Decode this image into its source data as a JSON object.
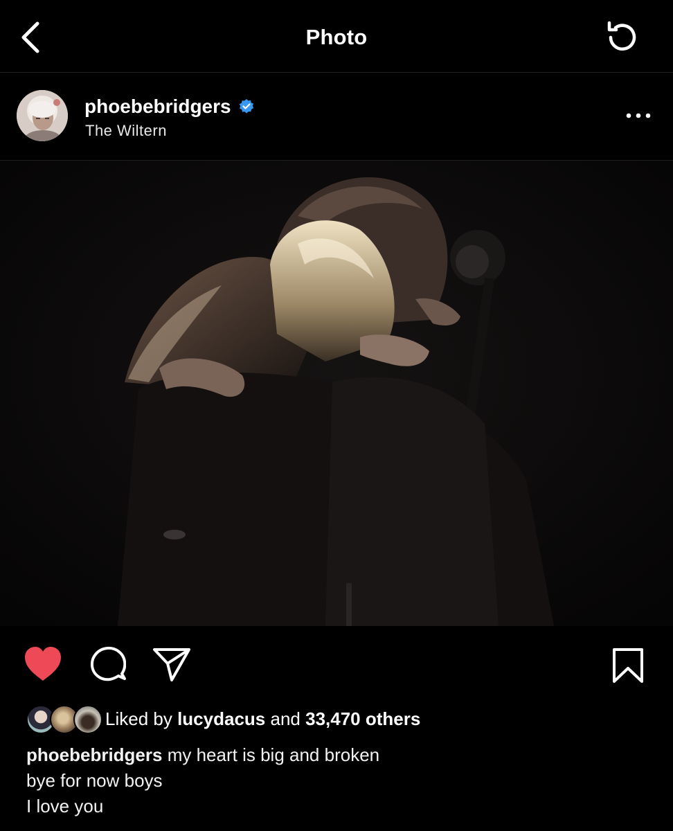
{
  "topbar": {
    "title": "Photo"
  },
  "post": {
    "username": "phoebebridgers",
    "location": "The Wiltern",
    "photo_alt": "",
    "likes": {
      "prefix": "Liked by",
      "liker": "lucydacus",
      "connector": "and",
      "others": "33,470 others"
    },
    "caption": {
      "username": "phoebebridgers",
      "line1": "my heart is big and broken",
      "line2": "bye for now boys",
      "line3": "I love you"
    }
  },
  "icons": {
    "back": "chevron-left-icon",
    "refresh": "refresh-icon",
    "more": "more-horizontal-icon",
    "like": "heart-icon",
    "comment": "comment-icon",
    "share": "send-icon",
    "save": "bookmark-icon",
    "verified": "verified-badge-icon"
  },
  "colors": {
    "background": "#000000",
    "like": "#ed4956",
    "verified": "#3897f0"
  }
}
